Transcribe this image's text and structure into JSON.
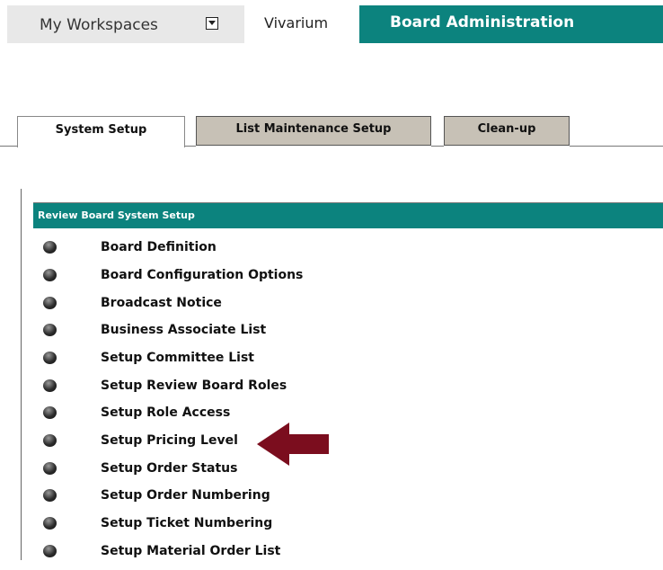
{
  "topnav": {
    "workspaces_label": "My Workspaces",
    "vivarium_label": "Vivarium",
    "board_admin_label": "Board Administration"
  },
  "tabs": [
    {
      "label": "System Setup"
    },
    {
      "label": "List Maintenance Setup"
    },
    {
      "label": "Clean-up"
    }
  ],
  "panel": {
    "title": "Review Board System Setup",
    "items": [
      {
        "label": "Board Definition"
      },
      {
        "label": "Board Configuration Options"
      },
      {
        "label": "Broadcast Notice"
      },
      {
        "label": "Business Associate List"
      },
      {
        "label": "Setup Committee List"
      },
      {
        "label": "Setup Review Board Roles"
      },
      {
        "label": "Setup Role Access"
      },
      {
        "label": "Setup Pricing Level"
      },
      {
        "label": "Setup Order Status"
      },
      {
        "label": "Setup Order Numbering"
      },
      {
        "label": "Setup Ticket Numbering"
      },
      {
        "label": "Setup Material Order List"
      }
    ]
  },
  "colors": {
    "accent": "#0c837e",
    "arrow": "#7b0d1e",
    "tab_inactive": "#c7c1b6"
  }
}
